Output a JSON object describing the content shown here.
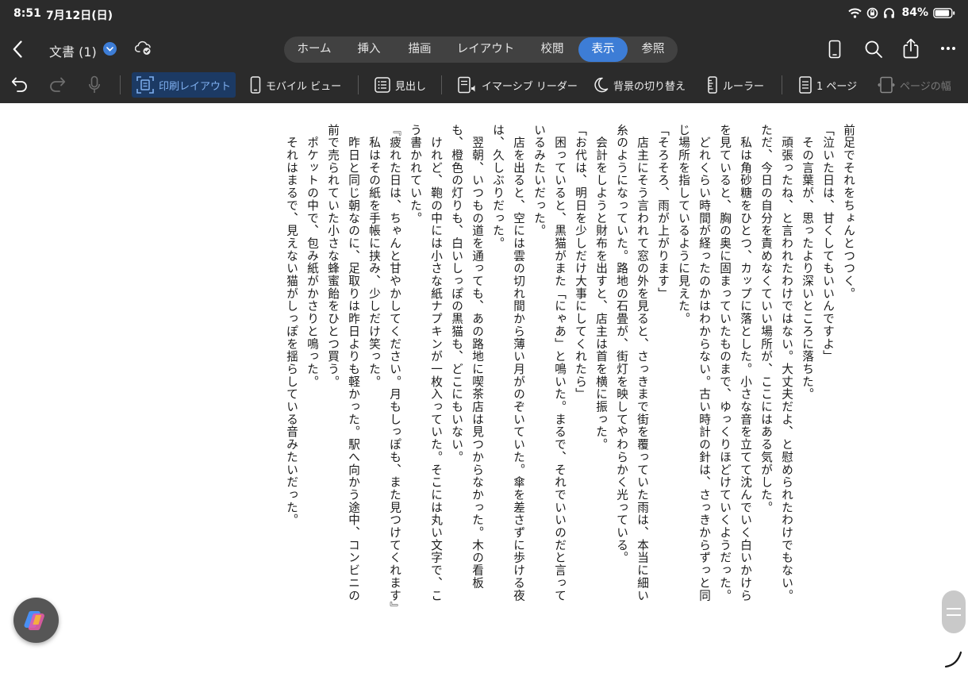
{
  "status_bar": {
    "time": "8:51",
    "date": "7月12日(日)",
    "battery": "84%"
  },
  "header": {
    "doc_title": "文書 (1)",
    "tabs": [
      {
        "label": "ホーム"
      },
      {
        "label": "挿入"
      },
      {
        "label": "描画"
      },
      {
        "label": "レイアウト"
      },
      {
        "label": "校閲"
      },
      {
        "label": "表示"
      },
      {
        "label": "参照"
      }
    ],
    "active_tab": "表示"
  },
  "toolbar": {
    "print_layout": "印刷レイアウト",
    "mobile_view": "モバイル ビュー",
    "headings": "見出し",
    "immersive_reader": "イマーシブ リーダー",
    "background_toggle": "背景の切り替え",
    "ruler": "ルーラー",
    "one_page": "1 ページ",
    "page_width": "ページの幅"
  },
  "document": {
    "lines": [
      "前足でそれをちょんとつつく。",
      "「泣いた日は、甘くしてもいいんですよ」",
      "　その言葉が、思ったより深いところに落ちた。",
      "　頑張ったね、と言われたわけではない。大丈夫だよ、と慰められたわけでもない。",
      "ただ、今日の自分を責めなくていい場所が、ここにはある気がした。",
      "　私は角砂糖をひとつ、カップに落とした。小さな音を立てて沈んでいく白いかけら",
      "を見ていると、胸の奥に固まっていたものまで、ゆっくりほどけていくようだった。",
      "　どれくらい時間が経ったのかはわからない。古い時計の針は、さっきからずっと同",
      "じ場所を指しているように見えた。",
      "「そろそろ、雨が上がります」",
      "　店主にそう言われて窓の外を見ると、さっきまで街を覆っていた雨は、本当に細い",
      "糸のようになっていた。路地の石畳が、街灯を映してやわらかく光っている。",
      "　会計をしようと財布を出すと、店主は首を横に振った。",
      "「お代は、明日を少しだけ大事にしてくれたら」",
      "　困っていると、黒猫がまた「にゃあ」と鳴いた。まるで、それでいいのだと言って",
      "いるみたいだった。",
      "　店を出ると、空には雲の切れ間から薄い月がのぞいていた。傘を差さずに歩ける夜",
      "は、久しぶりだった。",
      "　翌朝、いつもの道を通っても、あの路地に喫茶店は見つからなかった。木の看板",
      "も、橙色の灯りも、白いしっぽの黒猫も、どこにもいない。",
      "　けれど、鞄の中には小さな紙ナプキンが一枚入っていた。そこには丸い文字で、こ",
      "う書かれていた。",
      "『疲れた日は、ちゃんと甘やかしてください。月もしっぽも、また見つけてくれます』",
      "　私はその紙を手帳に挟み、少しだけ笑った。",
      "　昨日と同じ朝なのに、足取りは昨日よりも軽かった。駅へ向かう途中、コンビニの",
      "前で売られていた小さな蜂蜜飴をひとつ買う。",
      "　ポケットの中で、包み紙がかさりと鳴った。",
      "　それはまるで、見えない猫がしっぽを揺らしている音みたいだった。"
    ]
  }
}
